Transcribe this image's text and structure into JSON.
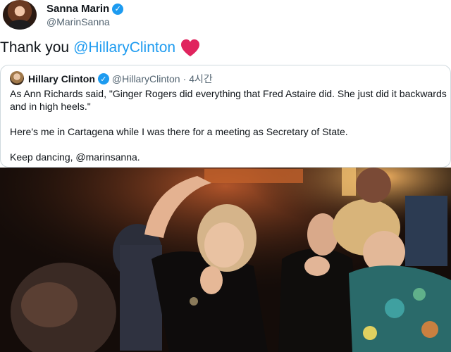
{
  "tweet": {
    "author_name": "Sanna Marin",
    "author_handle": "@MarinSanna",
    "text_prefix": "Thank you ",
    "mention": "@HillaryClinton"
  },
  "quoted_tweet": {
    "author_name": "Hillary Clinton",
    "author_handle": "@HillaryClinton",
    "separator": "·",
    "time": "4시간",
    "paragraphs": [
      "As Ann Richards said, \"Ginger Rogers did everything that Fred Astaire did. She just did it backwards and in high heels.\"",
      "Here's me in Cartagena while I was there for a meeting as Secretary of State.",
      "Keep dancing, @marinsanna."
    ]
  },
  "icons": {
    "verified": "verified-badge-icon",
    "heart": "red-heart-icon"
  },
  "colors": {
    "link": "#1d9bf0",
    "secondary_text": "#536471",
    "heart": "#e0245e",
    "border": "#cfd9de"
  }
}
